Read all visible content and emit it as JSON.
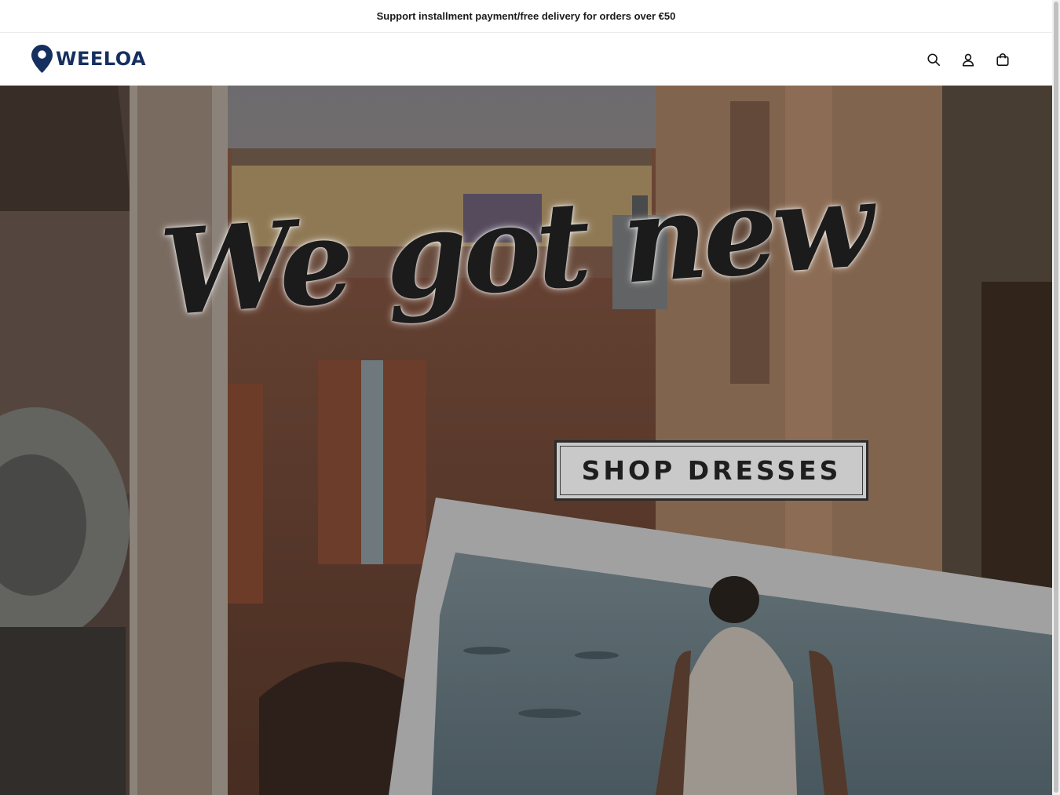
{
  "announcement": {
    "text": "Support installment payment/free delivery for orders over €50"
  },
  "header": {
    "logo_text": "WEELOA",
    "icons": [
      "search-icon",
      "account-icon",
      "cart-icon"
    ]
  },
  "hero": {
    "headline": "We got new",
    "button_label": "SHOP DRESSES"
  },
  "colors": {
    "brand": "#15305f",
    "announcement_text": "#1a1a1a",
    "hero_overlay": "#6b5a4e"
  }
}
